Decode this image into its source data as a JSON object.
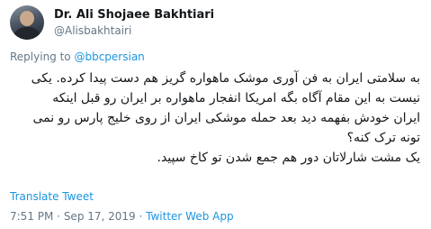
{
  "author": {
    "display_name": "Dr. Ali Shojaee Bakhtiari",
    "handle": "@Alisbakhtairi",
    "avatar_icon": "profile-photo"
  },
  "reply": {
    "prefix": "Replying to ",
    "target": "@bbcpersian"
  },
  "tweet": {
    "lines": [
      "به سلامتی ایران به فن آوری موشک ماهواره گریز هم دست پیدا کرده. یکی",
      "نیست به این مقام آگاه بگه امریکا انفجار ماهواره بر ایران رو قبل اینکه",
      "ایران خودش بفهمه دید بعد حمله موشکی ایران از روی خلیج پارس رو نمی",
      "تونه ترک کنه؟",
      "یک مشت شارلاتان دور هم جمع شدن تو کاخ سپید."
    ]
  },
  "translate_label": "Translate Tweet",
  "meta": {
    "time": "7:51 PM",
    "separator1": " · ",
    "date": "Sep 17, 2019",
    "separator2": " · ",
    "source": "Twitter Web App"
  },
  "colors": {
    "link": "#1b95e0",
    "secondary_text": "#657786",
    "primary_text": "#14171a"
  }
}
